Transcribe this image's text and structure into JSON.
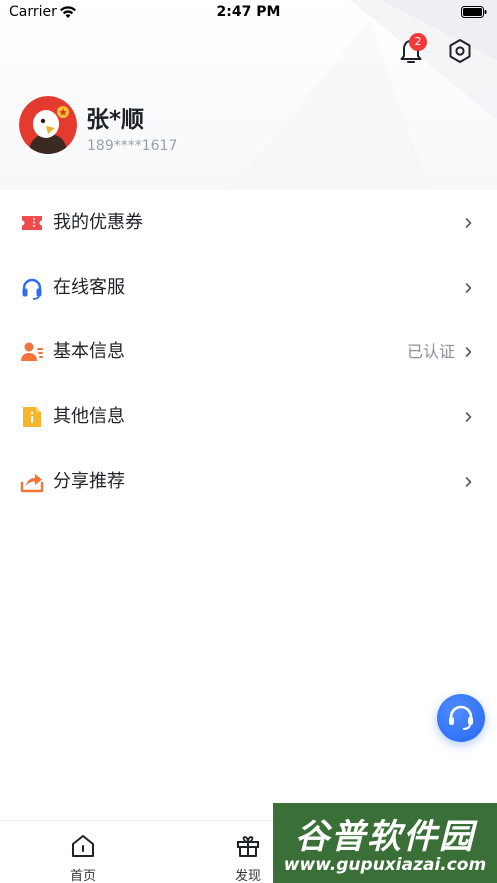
{
  "status_bar": {
    "carrier": "Carrier",
    "time": "2:47 PM"
  },
  "header": {
    "notification_count": "2",
    "user_name": "张*顺",
    "user_phone": "189****1617"
  },
  "menu": {
    "items": [
      {
        "label": "我的优惠券",
        "value": "",
        "icon": "coupon-icon",
        "color": "#f04a4a"
      },
      {
        "label": "在线客服",
        "value": "",
        "icon": "headset-icon",
        "color": "#2f6bf5"
      },
      {
        "label": "基本信息",
        "value": "已认证",
        "icon": "user-card-icon",
        "color": "#f5733a"
      },
      {
        "label": "其他信息",
        "value": "",
        "icon": "info-icon",
        "color": "#f7b52b"
      },
      {
        "label": "分享推荐",
        "value": "",
        "icon": "share-icon",
        "color": "#f5733a"
      }
    ]
  },
  "tabbar": {
    "tabs": [
      {
        "label": "首页",
        "icon": "home-icon"
      },
      {
        "label": "发现",
        "icon": "gift-icon"
      }
    ]
  },
  "watermark": {
    "title": "谷普软件园",
    "url": "www.gupuxiazai.com"
  },
  "colors": {
    "accent": "#2f6bf5",
    "badge": "#f23a3a",
    "text": "#1f2329",
    "muted": "#9aa0aa"
  }
}
